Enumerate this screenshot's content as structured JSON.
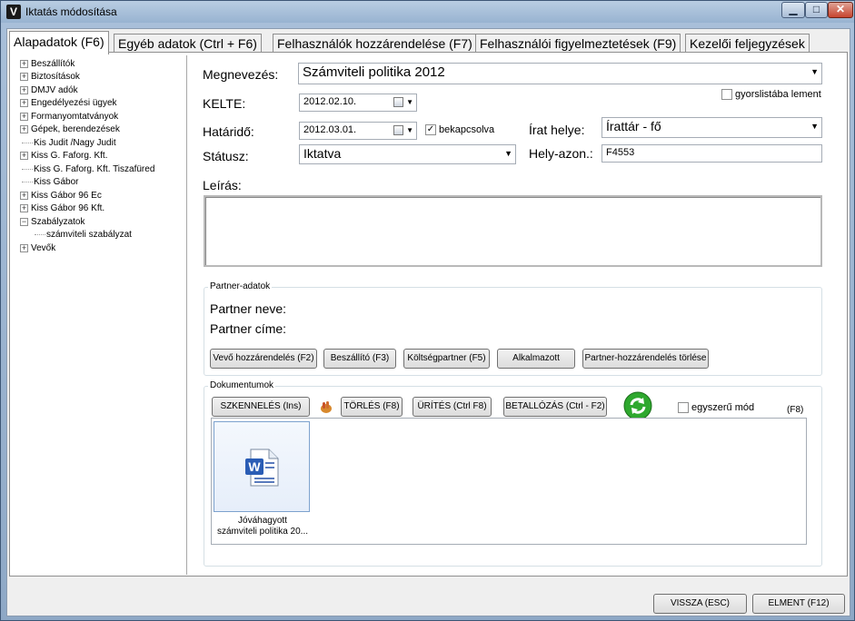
{
  "window": {
    "title": "Iktatás módosítása",
    "app_icon": "V",
    "min_glyph": "▁",
    "max_glyph": "□",
    "close_glyph": "✕"
  },
  "tabs": [
    {
      "label": "Alapadatok (F6)",
      "active": true
    },
    {
      "label": "Egyéb adatok (Ctrl + F6)"
    },
    {
      "label": "Felhasználók hozzárendelése (F7)"
    },
    {
      "label": "Felhasználói figyelmeztetések (F9)"
    },
    {
      "label": "Kezelői feljegyzések"
    }
  ],
  "tree": [
    {
      "label": "Beszállítók",
      "expander": "+"
    },
    {
      "label": "Biztosítások",
      "expander": "+"
    },
    {
      "label": "DMJV adók",
      "expander": "+"
    },
    {
      "label": "Engedélyezési ügyek",
      "expander": "+"
    },
    {
      "label": "Formanyomtatványok",
      "expander": "+"
    },
    {
      "label": "Gépek, berendezések",
      "expander": "+"
    },
    {
      "label": "Kis Judit /Nagy Judit",
      "expander": ""
    },
    {
      "label": "Kiss G. Faforg. Kft.",
      "expander": "+"
    },
    {
      "label": "Kiss G. Faforg. Kft. Tiszafüred",
      "expander": ""
    },
    {
      "label": "Kiss Gábor",
      "expander": ""
    },
    {
      "label": "Kiss Gábor 96 Ec",
      "expander": "+"
    },
    {
      "label": "Kiss Gábor 96 Kft.",
      "expander": "+"
    },
    {
      "label": "Szabályzatok",
      "expander": "−"
    },
    {
      "label": "számviteli szabályzat",
      "expander": "",
      "child": true
    },
    {
      "label": "Vevők",
      "expander": "+"
    }
  ],
  "form": {
    "megnevezes_label": "Megnevezés:",
    "megnevezes_value": "Számviteli politika 2012",
    "gyorslista_label": "gyorslistába lement",
    "kelte_label": "KELTE:",
    "kelte_value": "2012.02.10.",
    "hatarido_label": "Határidő:",
    "hatarido_value": "2012.03.01.",
    "bekapcsolva_label": "bekapcsolva",
    "bekapcsolva_checked": "✓",
    "irat_helye_label": "Írat helye:",
    "irat_helye_value": "Írattár - fő",
    "statusz_label": "Státusz:",
    "statusz_value": "Iktatva",
    "hely_azon_label": "Hely-azon.:",
    "hely_azon_value": "F4553",
    "leiras_label": "Leírás:",
    "dropdown_glyph": "▼"
  },
  "partner": {
    "group_title": "Partner-adatok",
    "neve_label": "Partner neve:",
    "cime_label": "Partner címe:",
    "buttons": {
      "vevo": "Vevő hozzárendelés (F2)",
      "beszallito": "Beszállító (F3)",
      "koltseg": "Költségpartner (F5)",
      "alkalmazott": "Alkalmazott",
      "torles": "Partner-hozzárendelés törlése"
    }
  },
  "documents": {
    "group_title": "Dokumentumok",
    "scan": "SZKENNELÉS (Ins)",
    "delete": "TÖRLÉS (F8)",
    "clear": "ÜRÍTÉS (Ctrl F8)",
    "load": "BETALLÓZÁS (Ctrl - F2)",
    "simple_mode": "egyszerű mód",
    "f8_hint": "(F8)",
    "file_caption_line1": "Jóváhagyott",
    "file_caption_line2": "számviteli politika 20...",
    "word_letter": "W"
  },
  "footer": {
    "back": "VISSZA (ESC)",
    "save": "ELMENT (F12)"
  }
}
